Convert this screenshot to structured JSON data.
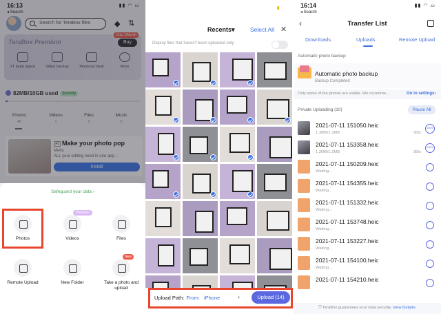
{
  "panel1": {
    "status": {
      "time": "16:13",
      "back": "◂ Search"
    },
    "search_placeholder": "Search for TeraBox files",
    "premium": {
      "title": "TeraBox Premium",
      "offer": "Only 1/Month",
      "buy": "Buy",
      "features": [
        "2T large space",
        "Video backup",
        "Personal Vault",
        "More"
      ]
    },
    "storage": {
      "used": "82MB/10GB used",
      "badge": "Security",
      "percent": 1
    },
    "categories": [
      {
        "label": "Photos",
        "count": "40"
      },
      {
        "label": "Videos",
        "count": "1"
      },
      {
        "label": "Files",
        "count": "0"
      },
      {
        "label": "Music",
        "count": "0"
      }
    ],
    "ad": {
      "tag": "Ad",
      "title": "Make your photo pop",
      "brand": "Meitu",
      "desc": "ALL your editing need in one app. :",
      "install": "Install"
    },
    "sheet": {
      "safeguard": "Safeguard your data ›",
      "items": [
        {
          "label": "Photos"
        },
        {
          "label": "Videos",
          "badge": "Premium"
        },
        {
          "label": "Files"
        },
        {
          "label": "Remote Upload"
        },
        {
          "label": "New Folder"
        },
        {
          "label": "Take a photo and upload",
          "badge": "New"
        }
      ]
    }
  },
  "panel2": {
    "recents": "Recents▾",
    "select_all": "Select All",
    "close": "✕",
    "hint": "Display files that haven't been uploaded only",
    "upload_path_label": "Upload Path:",
    "from": "From:",
    "device": "iPhone",
    "upload_button": "Upload (14)"
  },
  "panel3": {
    "status": {
      "time": "16:14",
      "back": "◂ Search"
    },
    "title": "Transfer List",
    "tabs": [
      "Downloads",
      "Uploads",
      "Remote Upload"
    ],
    "auto_label": "Automatic photo backup",
    "auto_title": "Automatic photo backup",
    "auto_sub": "Backup Completed",
    "notice": "Only some of the photos are visible. We recomme...",
    "goto": "Go to settings›",
    "private": "Private Uploading  (10)",
    "pause": "Pause All",
    "rows": [
      {
        "name": "2021-07-11 151050.heic",
        "meta": "1.3MB/1.3MB",
        "speed": "0B/s",
        "progress": "100%"
      },
      {
        "name": "2021-07-11 153358.heic",
        "meta": "1.2MB/1.2MB",
        "speed": "0B/s",
        "progress": "100%"
      },
      {
        "name": "2021-07-11 150209.heic",
        "meta": "Waiting..."
      },
      {
        "name": "2021-07-11 154355.heic",
        "meta": "Waiting..."
      },
      {
        "name": "2021-07-11 151332.heic",
        "meta": "Waiting..."
      },
      {
        "name": "2021-07-11 153748.heic",
        "meta": "Waiting..."
      },
      {
        "name": "2021-07-11 153227.heic",
        "meta": "Waiting..."
      },
      {
        "name": "2021-07-11 154100.heic",
        "meta": "Waiting..."
      },
      {
        "name": "2021-07-11 154210.heic",
        "meta": ""
      }
    ],
    "footer": "TeraBox guarantees your data security.",
    "footer_link": "View Details›"
  },
  "colors": {
    "accent": "#3b6fe0",
    "upload_button": "#5b68e0",
    "highlight": "#e7462d"
  }
}
